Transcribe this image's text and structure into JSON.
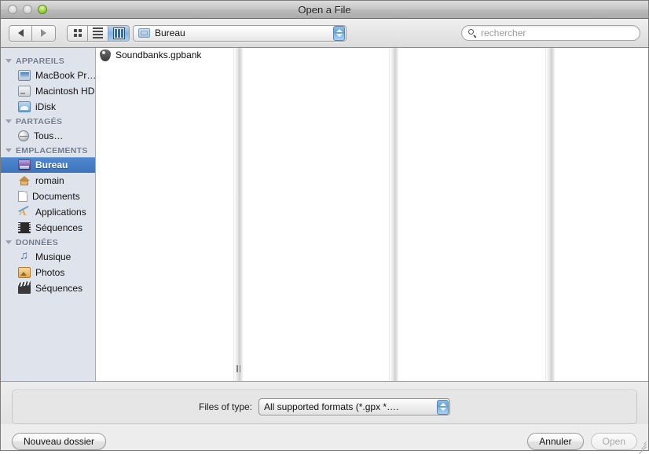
{
  "window": {
    "title": "Open a File"
  },
  "toolbar": {
    "back_icon": "back-arrow-icon",
    "forward_icon": "forward-arrow-icon",
    "view_icon_mode": "icon-view-icon",
    "view_list_mode": "list-view-icon",
    "view_column_mode": "column-view-icon",
    "path_popup": {
      "value": "Bureau",
      "icon": "folder-icon"
    },
    "search": {
      "placeholder": "rechercher",
      "value": "",
      "icon": "search-icon"
    }
  },
  "sidebar": {
    "sections": [
      {
        "title": "APPAREILS",
        "items": [
          {
            "label": "MacBook Pr…",
            "icon": "laptop-icon",
            "selected": false
          },
          {
            "label": "Macintosh HD",
            "icon": "harddisk-icon",
            "selected": false
          },
          {
            "label": "iDisk",
            "icon": "idisk-icon",
            "selected": false
          }
        ]
      },
      {
        "title": "PARTAGÉS",
        "items": [
          {
            "label": "Tous…",
            "icon": "globe-icon",
            "selected": false
          }
        ]
      },
      {
        "title": "EMPLACEMENTS",
        "items": [
          {
            "label": "Bureau",
            "icon": "desktop-icon",
            "selected": true
          },
          {
            "label": "romain",
            "icon": "home-icon",
            "selected": false
          },
          {
            "label": "Documents",
            "icon": "document-icon",
            "selected": false
          },
          {
            "label": "Applications",
            "icon": "applications-icon",
            "selected": false
          },
          {
            "label": "Séquences",
            "icon": "film-icon",
            "selected": false
          }
        ]
      },
      {
        "title": "DONNÉES",
        "items": [
          {
            "label": "Musique",
            "icon": "music-note-icon",
            "selected": false
          },
          {
            "label": "Photos",
            "icon": "photo-icon",
            "selected": false
          },
          {
            "label": "Séquences",
            "icon": "clapperboard-icon",
            "selected": false
          }
        ]
      }
    ]
  },
  "browser": {
    "columns": [
      {
        "items": [
          {
            "label": "Soundbanks.gpbank",
            "icon": "guitar-pick-icon",
            "selected": false
          }
        ]
      },
      {
        "items": []
      },
      {
        "items": []
      },
      {
        "items": []
      }
    ]
  },
  "footer": {
    "filetype_label": "Files of type:",
    "filetype_value": "All supported formats (*.gpx *….",
    "new_folder_button": "Nouveau dossier",
    "cancel_button": "Annuler",
    "open_button": "Open"
  },
  "colors": {
    "selection_blue": "#3d74bd",
    "sidebar_bg": "#dfe3ec",
    "header_text": "#717a8c",
    "panel_bg": "#e6e6e6"
  }
}
